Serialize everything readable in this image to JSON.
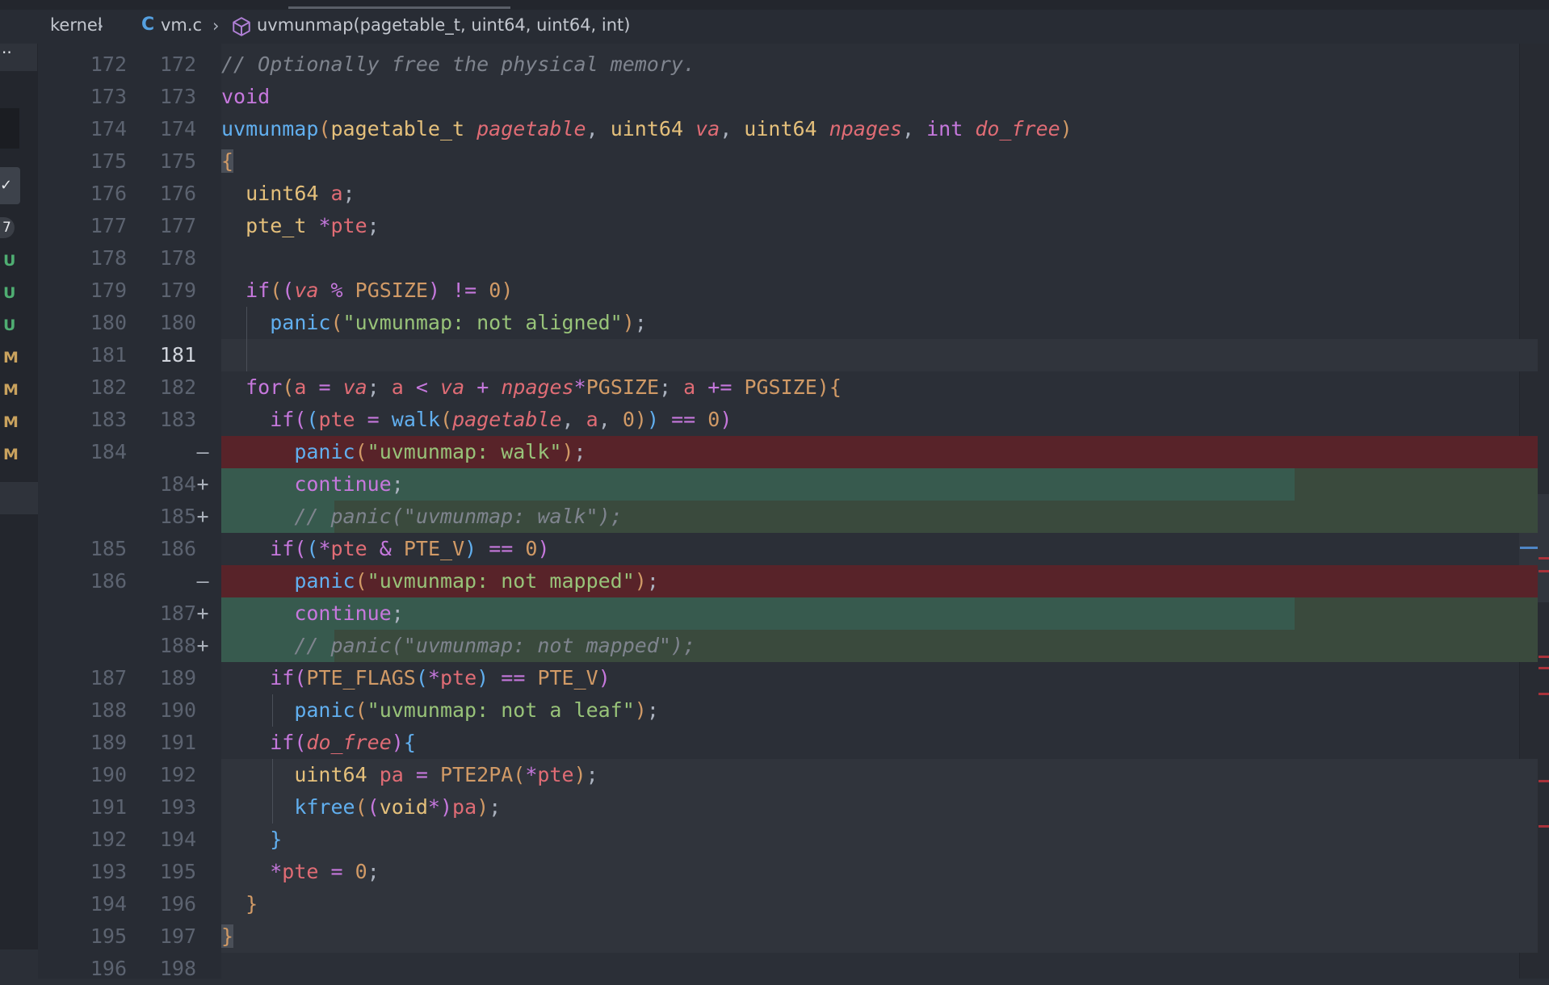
{
  "breadcrumb": {
    "folder": "kernel",
    "file_icon": "C",
    "file": "vm.c",
    "symbol": "uvmunmap(pagetable_t, uint64, uint64, int)"
  },
  "activity": {
    "more": "··",
    "count": "7",
    "status": [
      "U",
      "U",
      "U",
      "M",
      "M",
      "M",
      "M"
    ]
  },
  "lines": [
    {
      "o": "172",
      "n": "172",
      "m": ""
    },
    {
      "o": "173",
      "n": "173",
      "m": ""
    },
    {
      "o": "174",
      "n": "174",
      "m": ""
    },
    {
      "o": "175",
      "n": "175",
      "m": ""
    },
    {
      "o": "176",
      "n": "176",
      "m": ""
    },
    {
      "o": "177",
      "n": "177",
      "m": ""
    },
    {
      "o": "178",
      "n": "178",
      "m": ""
    },
    {
      "o": "179",
      "n": "179",
      "m": ""
    },
    {
      "o": "180",
      "n": "180",
      "m": ""
    },
    {
      "o": "181",
      "n": "181",
      "m": ""
    },
    {
      "o": "182",
      "n": "182",
      "m": ""
    },
    {
      "o": "183",
      "n": "183",
      "m": ""
    },
    {
      "o": "184",
      "n": "",
      "m": "—"
    },
    {
      "o": "",
      "n": "184",
      "m": "+"
    },
    {
      "o": "",
      "n": "185",
      "m": "+"
    },
    {
      "o": "185",
      "n": "186",
      "m": ""
    },
    {
      "o": "186",
      "n": "",
      "m": "—"
    },
    {
      "o": "",
      "n": "187",
      "m": "+"
    },
    {
      "o": "",
      "n": "188",
      "m": "+"
    },
    {
      "o": "187",
      "n": "189",
      "m": ""
    },
    {
      "o": "188",
      "n": "190",
      "m": ""
    },
    {
      "o": "189",
      "n": "191",
      "m": ""
    },
    {
      "o": "190",
      "n": "192",
      "m": ""
    },
    {
      "o": "191",
      "n": "193",
      "m": ""
    },
    {
      "o": "192",
      "n": "194",
      "m": ""
    },
    {
      "o": "193",
      "n": "195",
      "m": ""
    },
    {
      "o": "194",
      "n": "196",
      "m": ""
    },
    {
      "o": "195",
      "n": "197",
      "m": ""
    },
    {
      "o": "196",
      "n": "198",
      "m": ""
    }
  ],
  "code": {
    "l0_comment": "// Optionally free the physical memory.",
    "kw_void": "void",
    "fn_uvmunmap": "uvmunmap",
    "t_pagetable_t": "pagetable_t",
    "p_pagetable": "pagetable",
    "t_uint64": "uint64",
    "p_va": "va",
    "p_npages": "npages",
    "t_int": "int",
    "p_do_free": "do_free",
    "v_a": "a",
    "t_pte_t": "pte_t",
    "v_pte": "pte",
    "kw_if": "if",
    "kw_for": "for",
    "m_PGSIZE": "PGSIZE",
    "n_0": "0",
    "fn_panic": "panic",
    "fn_walk": "walk",
    "s_not_aligned": "\"uvmunmap: not aligned\"",
    "s_walk": "\"uvmunmap: walk\"",
    "kw_continue": "continue",
    "c_walk": "// panic(\"uvmunmap: walk\");",
    "m_PTE_V": "PTE_V",
    "s_not_mapped": "\"uvmunmap: not mapped\"",
    "c_not_mapped": "// panic(\"uvmunmap: not mapped\");",
    "m_PTE_FLAGS": "PTE_FLAGS",
    "s_not_leaf": "\"uvmunmap: not a leaf\"",
    "v_pa": "pa",
    "m_PTE2PA": "PTE2PA",
    "fn_kfree": "kfree",
    "t_void": "void"
  },
  "colors": {
    "deleted_line": "#582329",
    "inserted_line": "#375a4e",
    "accent_blue": "#61afef"
  }
}
